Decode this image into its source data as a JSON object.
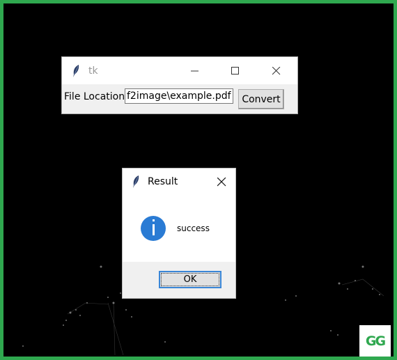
{
  "main_window": {
    "title": "tk",
    "file_location_label": "File Location",
    "file_location_value": "f2image\\example.pdf",
    "convert_label": "Convert"
  },
  "dialog": {
    "title": "Result",
    "message": "success",
    "ok_label": "OK",
    "icon": "info-icon"
  },
  "logo": {
    "text": "GG"
  },
  "colors": {
    "frame_border": "#2fa84f",
    "info_icon": "#2a7bd4",
    "ok_focus_border": "#3a86d6"
  }
}
